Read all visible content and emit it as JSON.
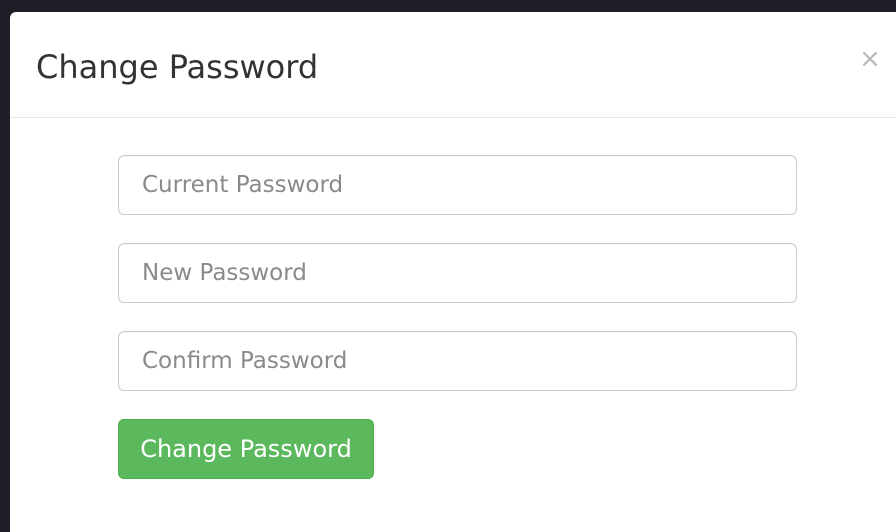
{
  "modal": {
    "title": "Change Password",
    "close_symbol": "×",
    "close_icon": "close-icon"
  },
  "form": {
    "current_password": {
      "placeholder": "Current Password",
      "value": ""
    },
    "new_password": {
      "placeholder": "New Password",
      "value": ""
    },
    "confirm_password": {
      "placeholder": "Confirm Password",
      "value": ""
    },
    "submit_label": "Change Password"
  },
  "colors": {
    "accent": "#5cb85c",
    "title_text": "#333333",
    "placeholder_text": "#8a8a8a"
  }
}
